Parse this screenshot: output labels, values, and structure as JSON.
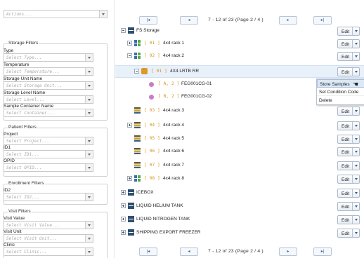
{
  "actions": {
    "placeholder": "Actions..."
  },
  "storage_filters": {
    "legend": "Storage Filters",
    "fields": [
      {
        "label": "Type",
        "placeholder": "Select Type..."
      },
      {
        "label": "Temperature",
        "placeholder": "Select Temperature..."
      },
      {
        "label": "Storage Unit Name",
        "placeholder": "Select Storage Unit..."
      },
      {
        "label": "Storage Level Name",
        "placeholder": "Select Level..."
      },
      {
        "label": "Sample Container Name",
        "placeholder": "Select Container..."
      }
    ]
  },
  "patient_filters": {
    "legend": "Patient Filters",
    "fields": [
      {
        "label": "Project",
        "placeholder": "Select Project..."
      },
      {
        "label": "ID1",
        "placeholder": "Select ID1..."
      },
      {
        "label": "OPID",
        "placeholder": "Select OPID..."
      }
    ]
  },
  "enrollment_filters": {
    "legend": "Enrollment Filters",
    "fields": [
      {
        "label": "ID2",
        "placeholder": "Select ID2..."
      }
    ]
  },
  "visit_filters": {
    "legend": "Visit Filters",
    "fields": [
      {
        "label": "Visit Value",
        "placeholder": "Select Visit Value..."
      },
      {
        "label": "Visit Unit",
        "placeholder": "Select Visit Unit..."
      },
      {
        "label": "Clinic",
        "placeholder": "Select Clinic..."
      }
    ]
  },
  "pager": {
    "first": "|◂",
    "prev": "◂",
    "next": "▸",
    "last": "▸|",
    "text": "7 - 12  of  23  (Page  2 / 4 )"
  },
  "tree": {
    "edit_label": "Edit",
    "rows": [
      {
        "name": "FS Storage",
        "code": "",
        "icon": "storage-icon"
      },
      {
        "name": "4x4 rack 1",
        "code": "[ 01 ]",
        "icon": "grid-icon"
      },
      {
        "name": "4x4 rack 2",
        "code": "[ 02 ]",
        "icon": "grid-icon"
      },
      {
        "name": "4X4 LRTB RR",
        "code": "[ 01 ]",
        "icon": "box-icon"
      },
      {
        "name": "FEG001CG-01",
        "code": "[ A, 2 ]",
        "icon": "sample-dot-icon"
      },
      {
        "name": "FEG001CG-02",
        "code": "[ B, 2 ]",
        "icon": "sample-dot-icon"
      },
      {
        "name": "4x4 rack 3",
        "code": "[ 03 ]",
        "icon": "shelf-icon"
      },
      {
        "name": "4x4 rack 4",
        "code": "[ 04 ]",
        "icon": "shelf-icon"
      },
      {
        "name": "4x4 rack 5",
        "code": "[ 05 ]",
        "icon": "shelf-icon"
      },
      {
        "name": "4x4 rack 6",
        "code": "[ 06 ]",
        "icon": "shelf-icon"
      },
      {
        "name": "4x4 rack 7",
        "code": "[ 07 ]",
        "icon": "shelf-icon"
      },
      {
        "name": "4x4 rack 8",
        "code": "[ 08 ]",
        "icon": "grid-icon"
      },
      {
        "name": "ICEBOX",
        "code": "",
        "icon": "storage-icon"
      },
      {
        "name": "LIQUID HELIUM TANK",
        "code": "",
        "icon": "storage-icon"
      },
      {
        "name": "LIQUID NITROGEN TANK",
        "code": "",
        "icon": "storage-icon"
      },
      {
        "name": "SHIPPING EXPORT FREEZER",
        "code": "",
        "icon": "storage-icon"
      }
    ]
  },
  "context_menu": {
    "items": [
      "Store Samples",
      "Set Condition Code",
      "Delete"
    ]
  }
}
